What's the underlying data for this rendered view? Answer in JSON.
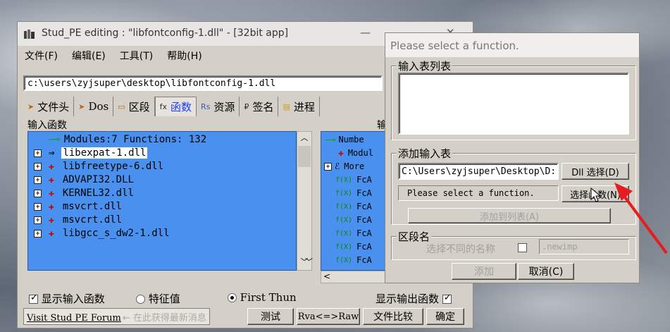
{
  "window": {
    "title": "Stud_PE editing : \"libfontconfig-1.dll\" - [32bit app]",
    "min_glyph": "—",
    "close_glyph": "✕"
  },
  "menu": [
    "文件(F)",
    "编辑(E)",
    "工具(T)",
    "帮助(H)"
  ],
  "path": "c:\\users\\zyjsuper\\desktop\\libfontconfig-1.dll",
  "tabs": [
    {
      "icon": "➤",
      "label": "文件头"
    },
    {
      "icon": "➤",
      "label": "Dos"
    },
    {
      "icon": "▭",
      "label": "区段"
    },
    {
      "icon": "fx",
      "label": "函数"
    },
    {
      "icon": "Rs",
      "label": "资源"
    },
    {
      "icon": "₽",
      "label": "签名"
    },
    {
      "icon": "▤",
      "label": "进程"
    }
  ],
  "imports_label": "输入函数",
  "exports_label": "输",
  "tree_left": {
    "root": "Modules:7 Functions: 132",
    "modules": [
      "libexpat-1.dll",
      "libfreetype-6.dll",
      "ADVAPI32.DLL",
      "KERNEL32.dll",
      "msvcrt.dll",
      "msvcrt.dll",
      "libgcc_s_dw2-1.dll"
    ],
    "selected_index": 0
  },
  "tree_right": {
    "rows": [
      "Numbe",
      "Modul",
      "More",
      "FcA",
      "FcA",
      "FcA",
      "FcA",
      "FcA",
      "FcA",
      "FcA"
    ],
    "fx_label": "f(X)"
  },
  "bottom": {
    "show_imports": "显示输入函数",
    "rva_label": "特征值",
    "first_thunk": "First Thun",
    "show_exports": "显示输出函数",
    "forum": "Visit Stud PE Forum",
    "forum_hint": "← 在此获得最新消息",
    "test": "测试",
    "rva_raw": "Rva<=>Raw",
    "compare": "文件比较",
    "ok": "确定"
  },
  "dialog": {
    "title": "Please select a function.",
    "list_group": "输入表列表",
    "add_group": "添加输入表",
    "dll_path": "C:\\Users\\zyjsuper\\Desktop\\D:",
    "select_dll": "Dll 选择(D)",
    "func_value": "Please select a function.",
    "select_func": "选择函数(N)",
    "add_to_list": "添加到列表(A)",
    "section_group": "区段名",
    "diff_name": "选择不同的名称",
    "section_name": ".newimp",
    "add": "添加",
    "cancel": "取消(C)"
  }
}
